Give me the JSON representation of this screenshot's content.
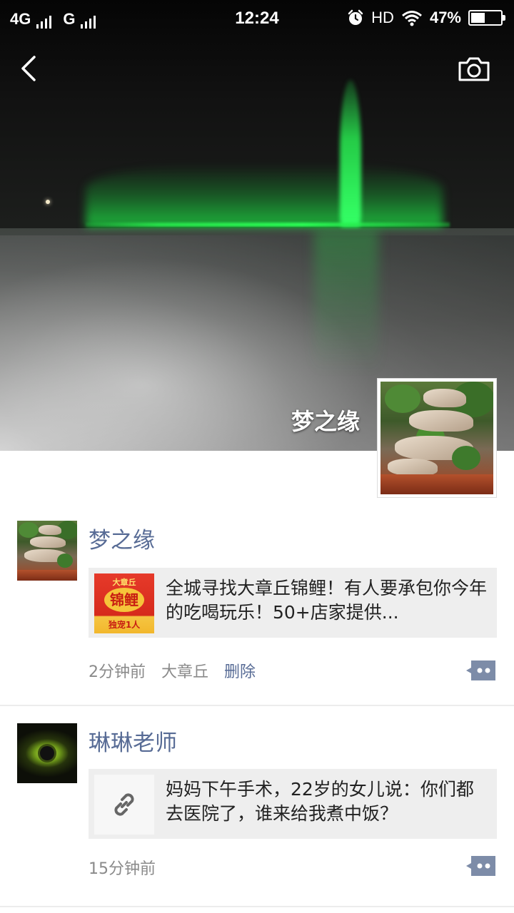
{
  "status_bar": {
    "network_1": "4G",
    "network_2": "G",
    "time": "12:24",
    "hd": "HD",
    "battery_text": "47%",
    "battery_level": 0.47
  },
  "nav": {
    "back_icon": "chevron-left-icon",
    "camera_icon": "camera-icon"
  },
  "cover": {
    "name": "梦之缘"
  },
  "posts": [
    {
      "username": "梦之缘",
      "link_text": "全城寻找大章丘锦鲤！有人要承包你今年的吃喝玩乐！50+店家提供...",
      "thumb": {
        "top": "大章丘",
        "main": "锦鲤",
        "bottom": "独宠1人"
      },
      "time": "2分钟前",
      "location": "大章丘",
      "delete_label": "删除"
    },
    {
      "username": "琳琳老师",
      "link_text": "妈妈下午手术，22岁的女儿说：你们都去医院了，谁来给我煮中饭？",
      "time": "15分钟前"
    }
  ],
  "colors": {
    "link_blue": "#576b95",
    "meta_gray": "#8a8a8a",
    "card_bg": "#eeeeee",
    "fountain_green": "#2bff55"
  }
}
